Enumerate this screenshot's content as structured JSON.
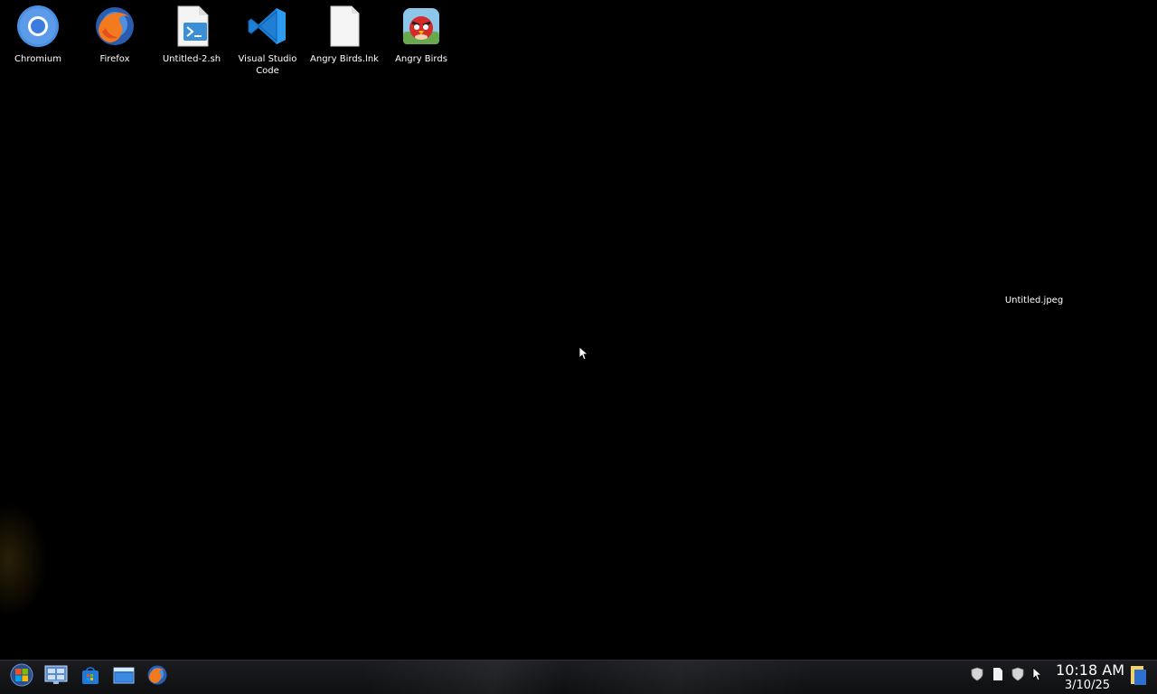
{
  "desktop": {
    "icons": [
      {
        "label": "Chromium",
        "icon": "chromium-icon"
      },
      {
        "label": "Firefox",
        "icon": "firefox-icon"
      },
      {
        "label": "Untitled-2.sh",
        "icon": "shell-script-icon"
      },
      {
        "label": "Visual Studio Code",
        "icon": "vscode-icon"
      },
      {
        "label": "Angry Birds.lnk",
        "icon": "blank-file-icon"
      },
      {
        "label": "Angry Birds",
        "icon": "angry-birds-icon"
      }
    ],
    "loose_label": "Untitled.jpeg"
  },
  "taskbar": {
    "buttons": [
      {
        "icon": "start-menu-icon"
      },
      {
        "icon": "desktop-switcher-icon"
      },
      {
        "icon": "store-bag-icon"
      },
      {
        "icon": "file-manager-icon"
      },
      {
        "icon": "firefox-icon"
      }
    ],
    "tray": [
      {
        "icon": "shield-icon"
      },
      {
        "icon": "document-icon"
      },
      {
        "icon": "shield-icon"
      },
      {
        "icon": "cursor-icon"
      }
    ],
    "clock": {
      "time": "10:18 AM",
      "date": "3/10/25"
    }
  }
}
